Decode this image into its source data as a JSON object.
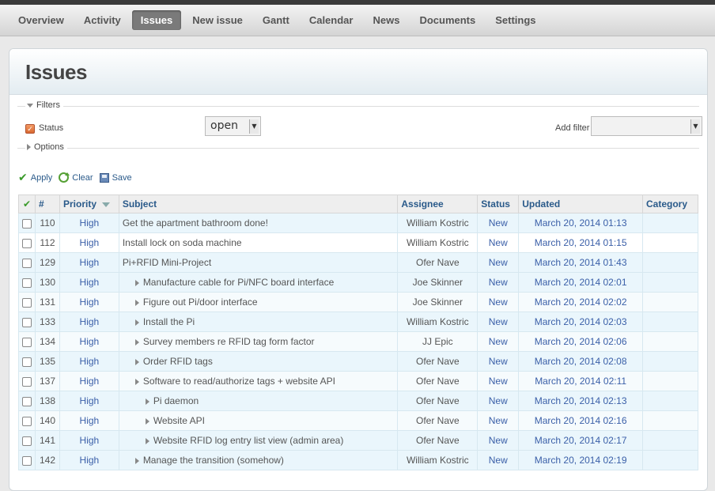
{
  "menu": {
    "tabs": [
      {
        "label": "Overview"
      },
      {
        "label": "Activity"
      },
      {
        "label": "Issues"
      },
      {
        "label": "New issue"
      },
      {
        "label": "Gantt"
      },
      {
        "label": "Calendar"
      },
      {
        "label": "News"
      },
      {
        "label": "Documents"
      },
      {
        "label": "Settings"
      }
    ],
    "selected": "Issues"
  },
  "page": {
    "title": "Issues"
  },
  "filters": {
    "legend": "Filters",
    "status_label": "Status",
    "status_value": "open",
    "add_filter_label": "Add filter",
    "add_filter_value": ""
  },
  "options": {
    "legend": "Options"
  },
  "actions": {
    "apply": "Apply",
    "clear": "Clear",
    "save": "Save"
  },
  "table": {
    "headers": {
      "id": "#",
      "priority": "Priority",
      "subject": "Subject",
      "assignee": "Assignee",
      "status": "Status",
      "updated": "Updated",
      "category": "Category"
    },
    "rows": [
      {
        "id": "110",
        "priority": "High",
        "subject": "Get the apartment bathroom done!",
        "level": 0,
        "assignee": "William Kostric",
        "status": "New",
        "updated": "March 20, 2014 01:13",
        "category": ""
      },
      {
        "id": "112",
        "priority": "High",
        "subject": "Install lock on soda machine",
        "level": 0,
        "assignee": "William Kostric",
        "status": "New",
        "updated": "March 20, 2014 01:15",
        "category": ""
      },
      {
        "id": "129",
        "priority": "High",
        "subject": "Pi+RFID Mini-Project",
        "level": 0,
        "assignee": "Ofer Nave",
        "status": "New",
        "updated": "March 20, 2014 01:43",
        "category": ""
      },
      {
        "id": "130",
        "priority": "High",
        "subject": "Manufacture cable for Pi/NFC board interface",
        "level": 1,
        "assignee": "Joe Skinner",
        "status": "New",
        "updated": "March 20, 2014 02:01",
        "category": ""
      },
      {
        "id": "131",
        "priority": "High",
        "subject": "Figure out Pi/door interface",
        "level": 1,
        "assignee": "Joe Skinner",
        "status": "New",
        "updated": "March 20, 2014 02:02",
        "category": ""
      },
      {
        "id": "133",
        "priority": "High",
        "subject": "Install the Pi",
        "level": 1,
        "assignee": "William Kostric",
        "status": "New",
        "updated": "March 20, 2014 02:03",
        "category": ""
      },
      {
        "id": "134",
        "priority": "High",
        "subject": "Survey members re RFID tag form factor",
        "level": 1,
        "assignee": "JJ Epic",
        "status": "New",
        "updated": "March 20, 2014 02:06",
        "category": ""
      },
      {
        "id": "135",
        "priority": "High",
        "subject": "Order RFID tags",
        "level": 1,
        "assignee": "Ofer Nave",
        "status": "New",
        "updated": "March 20, 2014 02:08",
        "category": ""
      },
      {
        "id": "137",
        "priority": "High",
        "subject": "Software to read/authorize tags + website API",
        "level": 1,
        "assignee": "Ofer Nave",
        "status": "New",
        "updated": "March 20, 2014 02:11",
        "category": ""
      },
      {
        "id": "138",
        "priority": "High",
        "subject": "Pi daemon",
        "level": 2,
        "assignee": "Ofer Nave",
        "status": "New",
        "updated": "March 20, 2014 02:13",
        "category": ""
      },
      {
        "id": "140",
        "priority": "High",
        "subject": "Website API",
        "level": 2,
        "assignee": "Ofer Nave",
        "status": "New",
        "updated": "March 20, 2014 02:16",
        "category": ""
      },
      {
        "id": "141",
        "priority": "High",
        "subject": "Website RFID log entry list view (admin area)",
        "level": 2,
        "assignee": "Ofer Nave",
        "status": "New",
        "updated": "March 20, 2014 02:17",
        "category": ""
      },
      {
        "id": "142",
        "priority": "High",
        "subject": "Manage the transition (somehow)",
        "level": 1,
        "assignee": "William Kostric",
        "status": "New",
        "updated": "March 20, 2014 02:19",
        "category": ""
      }
    ]
  }
}
